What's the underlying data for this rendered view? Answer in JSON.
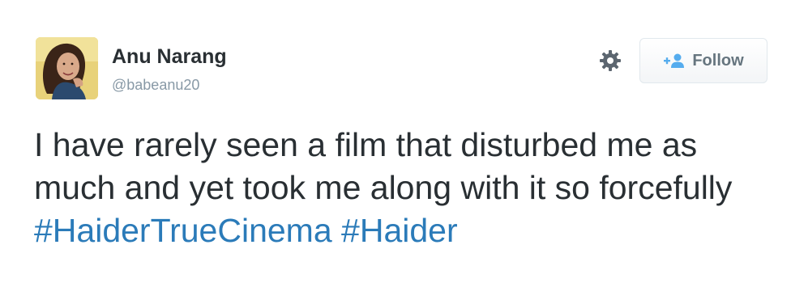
{
  "user": {
    "name": "Anu Narang",
    "handle": "@babeanu20",
    "avatar_icon": "profile-photo"
  },
  "actions": {
    "settings_icon": "gear-icon",
    "follow_icon": "add-user-icon",
    "follow_label": "Follow"
  },
  "tweet": {
    "text": "I have rarely seen a film that disturbed me as much and yet took me along with it so forcefully",
    "hashtags": [
      "#HaiderTrueCinema",
      "#Haider"
    ]
  },
  "colors": {
    "name": "#292f33",
    "handle": "#8899a6",
    "hashtag": "#2b7bb9",
    "follow_text": "#66757f",
    "follow_icon": "#55acee"
  }
}
